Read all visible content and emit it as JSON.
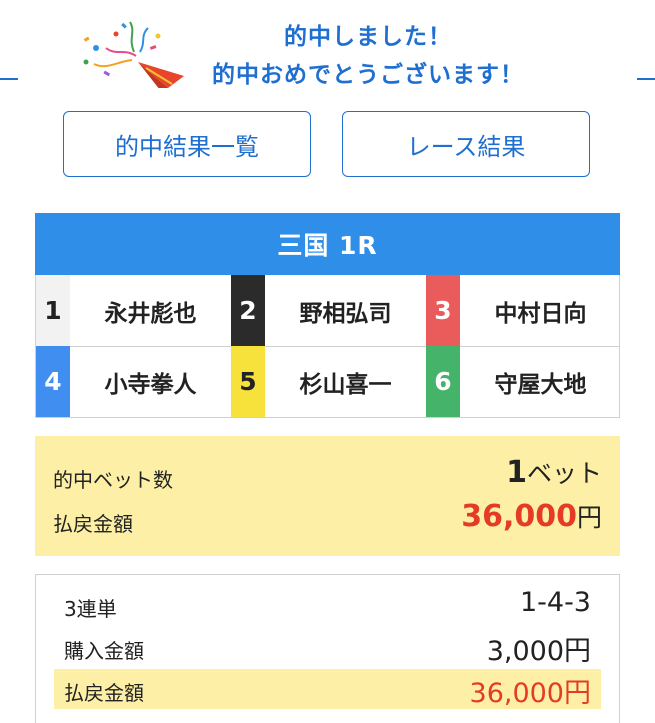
{
  "header": {
    "line1": "的中しました！",
    "line2": "的中おめでとうございます！"
  },
  "buttons": {
    "hit_list": "的中結果一覧",
    "race_result": "レース結果"
  },
  "race": {
    "title": "三国 1R"
  },
  "racers": [
    {
      "num": "1",
      "name": "永井彪也",
      "bg": "#f2f2f2",
      "fg": "#222222"
    },
    {
      "num": "2",
      "name": "野相弘司",
      "bg": "#2b2b2b",
      "fg": "#ffffff"
    },
    {
      "num": "3",
      "name": "中村日向",
      "bg": "#ea5b5b",
      "fg": "#ffffff"
    },
    {
      "num": "4",
      "name": "小寺拳人",
      "bg": "#3f8ef0",
      "fg": "#ffffff"
    },
    {
      "num": "5",
      "name": "杉山喜一",
      "bg": "#f7e23b",
      "fg": "#222222"
    },
    {
      "num": "6",
      "name": "守屋大地",
      "bg": "#46b36a",
      "fg": "#ffffff"
    }
  ],
  "summary": {
    "bets_label": "的中ベット数",
    "bets_value": "1",
    "bets_unit": "ベット",
    "payout_label": "払戻金額",
    "payout_value": "36,000",
    "payout_unit": "円"
  },
  "detail": {
    "type_label": "3連単",
    "type_value": "1-4-3",
    "purchase_label": "購入金額",
    "purchase_value": "3,000円",
    "payout_label": "払戻金額",
    "payout_value": "36,000円"
  }
}
